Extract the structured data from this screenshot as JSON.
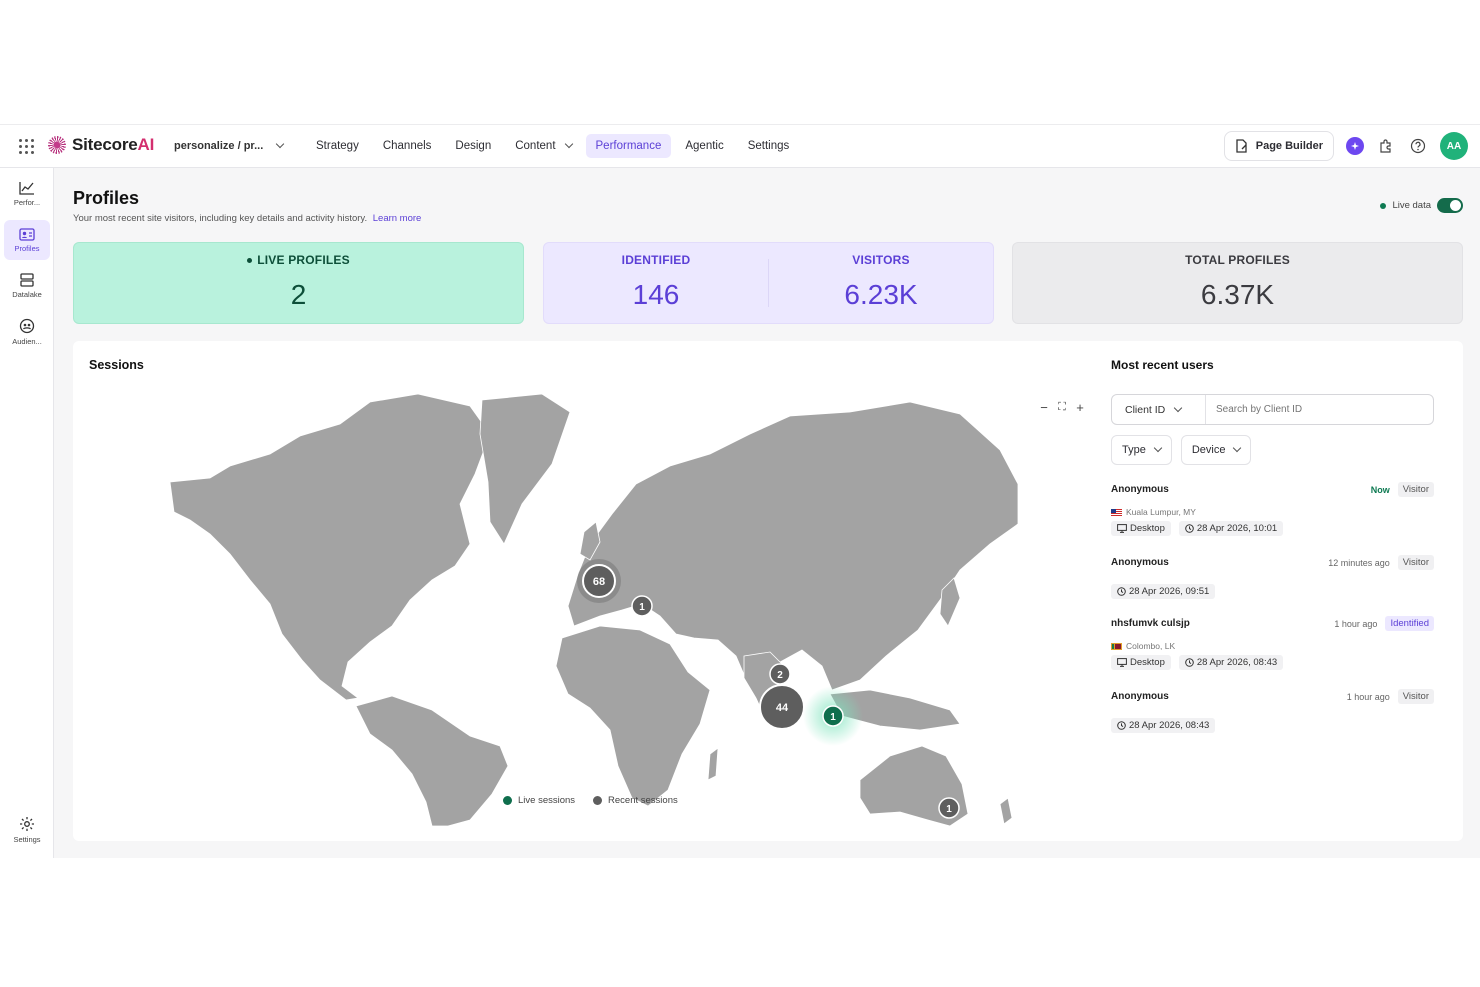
{
  "topbar": {
    "logo_text": "Sitecore",
    "logo_suffix": "AI",
    "site_selector": "personalize / pr...",
    "nav": [
      "Strategy",
      "Channels",
      "Design",
      "Content",
      "Performance",
      "Agentic",
      "Settings"
    ],
    "active_nav": "Performance",
    "page_builder": "Page Builder",
    "avatar_initials": "AA"
  },
  "sidebar": {
    "items": [
      "Perfor...",
      "Profiles",
      "Datalake",
      "Audien..."
    ],
    "active": "Profiles",
    "settings": "Settings"
  },
  "header": {
    "title": "Profiles",
    "subtitle": "Your most recent site visitors, including key details and activity history.",
    "learn_more": "Learn more",
    "live_data": "Live data",
    "live_data_on": true
  },
  "stats": {
    "live_label": "LIVE PROFILES",
    "live_value": "2",
    "identified_label": "IDENTIFIED",
    "identified_value": "146",
    "visitors_label": "VISITORS",
    "visitors_value": "6.23K",
    "total_label": "TOTAL PROFILES",
    "total_value": "6.37K"
  },
  "sessions": {
    "title": "Sessions",
    "clusters": [
      "68",
      "1",
      "2",
      "44",
      "1",
      "1"
    ],
    "live_cluster": "1",
    "legend_live": "Live sessions",
    "legend_recent": "Recent sessions",
    "zoom_out": "−",
    "zoom_fit": "⛶",
    "zoom_in": "+"
  },
  "recent_users": {
    "title": "Most recent users",
    "search_type": "Client ID",
    "search_placeholder": "Search by Client ID",
    "filter_type": "Type",
    "filter_device": "Device",
    "users": [
      {
        "name": "Anonymous",
        "time": "Now",
        "type": "Visitor",
        "location": "Kuala Lumpur, MY",
        "device": "Desktop",
        "date": "28 Apr 2026, 10:01"
      },
      {
        "name": "Anonymous",
        "time": "12 minutes ago",
        "type": "Visitor",
        "date": "28 Apr 2026, 09:51"
      },
      {
        "name": "nhsfumvk culsjp",
        "time": "1 hour ago",
        "type": "Identified",
        "location": "Colombo, LK",
        "device": "Desktop",
        "date": "28 Apr 2026, 08:43"
      },
      {
        "name": "Anonymous",
        "time": "1 hour ago",
        "type": "Visitor",
        "date": "28 Apr 2026, 08:43"
      }
    ]
  },
  "colors": {
    "accent": "#5b3fd6",
    "live_green": "#0e7a52",
    "map_land": "#a3a3a3",
    "cluster": "#5e5e5e"
  }
}
